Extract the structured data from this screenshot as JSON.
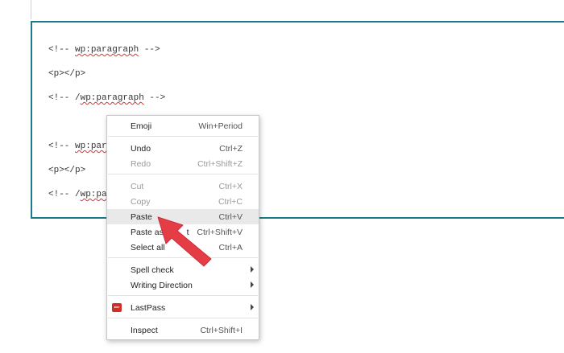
{
  "editor": {
    "lines": [
      {
        "pre": "<!-- ",
        "tag": "wp:paragraph",
        "post": " -->"
      },
      {
        "text": "<p></p>"
      },
      {
        "pre": "<!-- /",
        "tag": "wp:paragraph",
        "post": " -->"
      },
      {
        "pre": "<!-- ",
        "tag": "wp:par",
        "post": ""
      },
      {
        "text": "<p></p>"
      },
      {
        "pre": "<!-- /",
        "tag": "wp:pa",
        "post": ""
      }
    ]
  },
  "context_menu": {
    "emoji": {
      "label": "Emoji",
      "shortcut": "Win+Period"
    },
    "undo": {
      "label": "Undo",
      "shortcut": "Ctrl+Z"
    },
    "redo": {
      "label": "Redo",
      "shortcut": "Ctrl+Shift+Z"
    },
    "cut": {
      "label": "Cut",
      "shortcut": "Ctrl+X"
    },
    "copy": {
      "label": "Copy",
      "shortcut": "Ctrl+C"
    },
    "paste": {
      "label": "Paste",
      "shortcut": "Ctrl+V"
    },
    "paste_plain": {
      "label": "Paste as p",
      "label_tail": "t",
      "shortcut": "Ctrl+Shift+V"
    },
    "select_all": {
      "label": "Select all",
      "shortcut": "Ctrl+A"
    },
    "spell_check": {
      "label": "Spell check"
    },
    "writing_direction": {
      "label": "Writing Direction"
    },
    "lastpass": {
      "label": "LastPass"
    },
    "inspect": {
      "label": "Inspect",
      "shortcut": "Ctrl+Shift+I"
    }
  },
  "colors": {
    "editor_border": "#1c7b8a",
    "highlight": "#e9e9e9",
    "arrow": "#e53d46",
    "lastpass": "#d32d27"
  },
  "icons": {
    "lastpass": "lastpass-icon",
    "annotation": "red-arrow-icon"
  }
}
